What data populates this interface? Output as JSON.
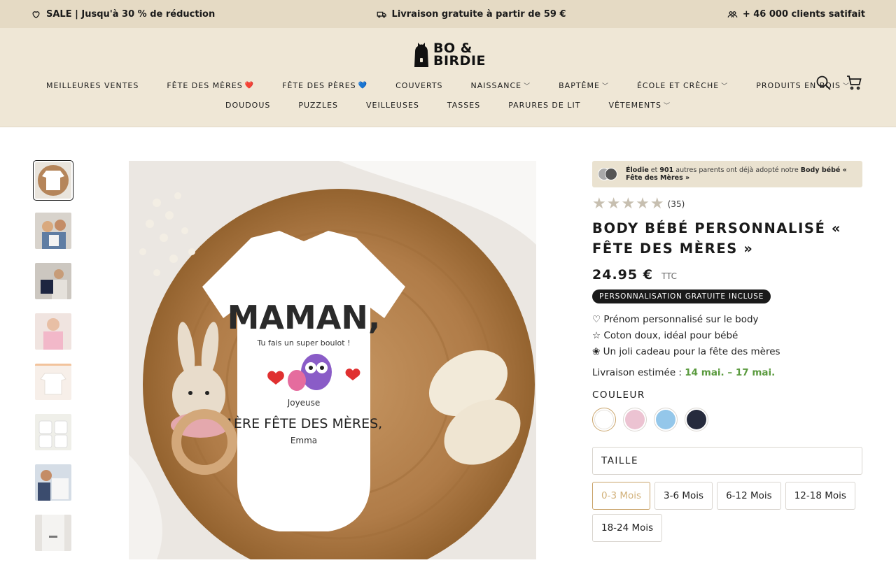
{
  "announcement": {
    "left": "SALE | Jusqu'à 30 % de réduction",
    "center": "Livraison gratuite à partir de 59 €",
    "right": "+ 46 000 clients satifait"
  },
  "brand": {
    "line1": "BO &",
    "line2": "BIRDIE"
  },
  "nav": {
    "row1": [
      {
        "label": "MEILLEURES VENTES"
      },
      {
        "label": "FÊTE DES MÈRES",
        "emoji": "❤️"
      },
      {
        "label": "FÊTE DES PÈRES",
        "emoji": "💙"
      },
      {
        "label": "COUVERTS"
      },
      {
        "label": "NAISSANCE",
        "dropdown": true
      },
      {
        "label": "BAPTÊME",
        "dropdown": true
      },
      {
        "label": "ÉCOLE ET CRÈCHE",
        "dropdown": true
      },
      {
        "label": "PRODUITS EN BOIS",
        "dropdown": true
      }
    ],
    "row2": [
      {
        "label": "DOUDOUS"
      },
      {
        "label": "PUZZLES"
      },
      {
        "label": "VEILLEUSES"
      },
      {
        "label": "TASSES"
      },
      {
        "label": "PARURES DE LIT"
      },
      {
        "label": "VÊTEMENTS",
        "dropdown": true
      }
    ]
  },
  "product": {
    "social_name": "Élodie",
    "social_mid": " et ",
    "social_count": "901",
    "social_text": " autres parents ont déjà adopté notre ",
    "social_product": "Body bébé « Fête des Mères »",
    "stars": "★★★★★",
    "rating_value": 5,
    "review_count": "(35)",
    "title": "BODY BÉBÉ PERSONNALISÉ « FÊTE DES MÈRES »",
    "price": "24.95 €",
    "tax": "TTC",
    "badge": "PERSONNALISATION GRATUITE INCLUSE",
    "features": [
      "♡ Prénom personnalisé sur le body",
      "☆ Coton doux, idéal pour bébé",
      "❀ Un joli cadeau pour la fête des mères"
    ],
    "delivery_label": "Livraison estimée : ",
    "delivery_dates": "14 mai. – 17 mai.",
    "color_label": "COULEUR",
    "colors": [
      "#ffffff",
      "#ecc3d2",
      "#94c7ea",
      "#262b3d"
    ],
    "size_label": "TAILLE",
    "sizes": [
      "0-3 Mois",
      "3-6 Mois",
      "6-12 Mois",
      "12-18 Mois",
      "18-24 Mois"
    ]
  },
  "image_text": {
    "headline": "MAMAN,",
    "sub": "Tu fais un super boulot !",
    "joyeuse": "Joyeuse",
    "line": "1ÈRE FÊTE DES MÈRES,",
    "name": "Emma"
  },
  "colors": {
    "topbar": "#e5dac4",
    "header": "#efe7d6",
    "accent": "#c9a36a",
    "delivery": "#5a9a3e"
  }
}
